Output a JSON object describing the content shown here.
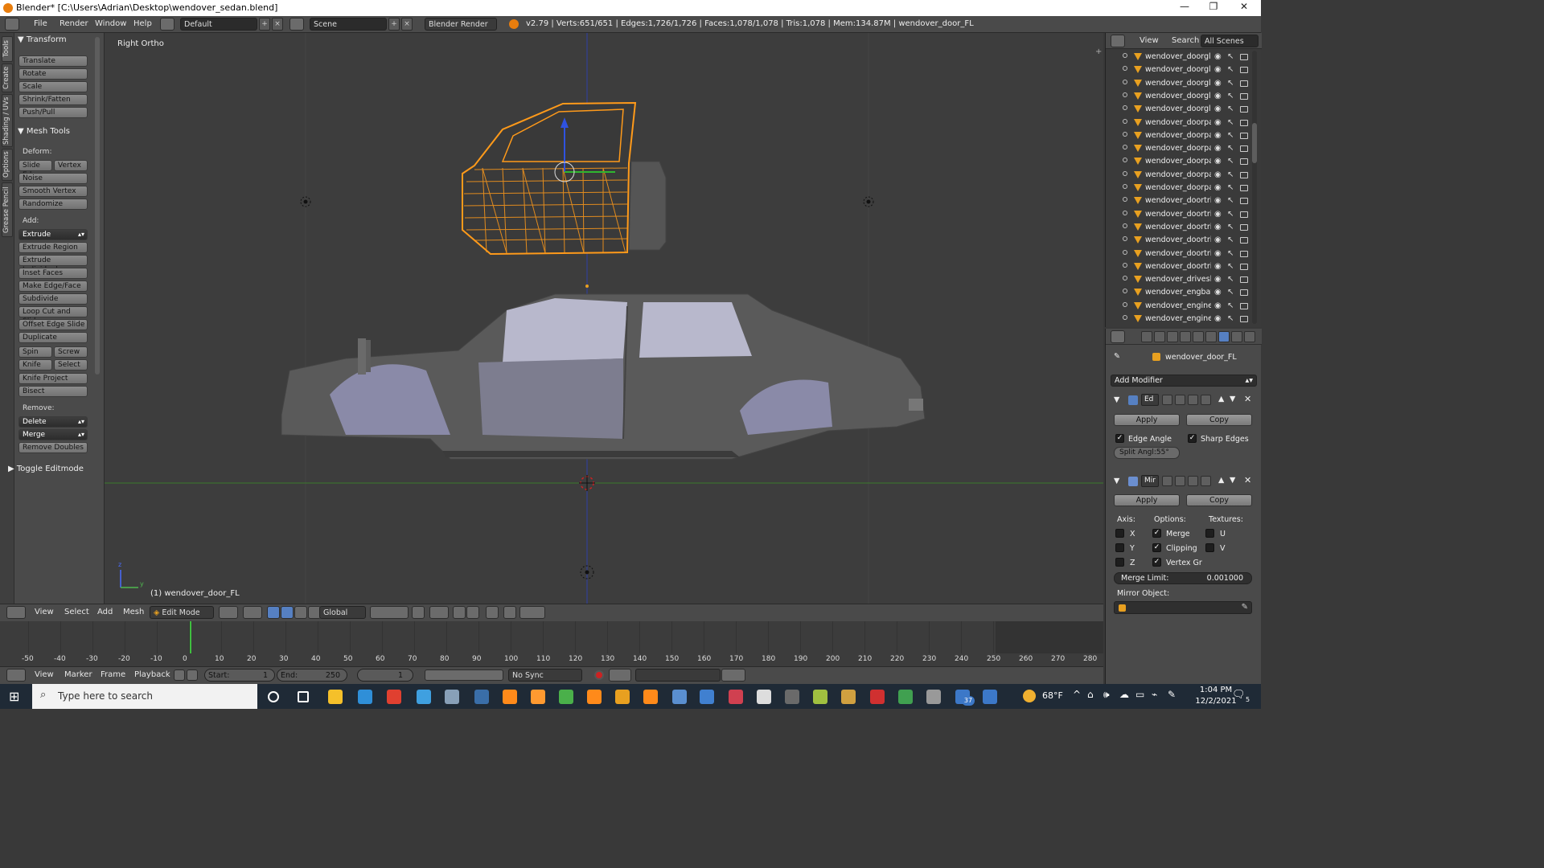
{
  "window": {
    "title": "Blender* [C:\\Users\\Adrian\\Desktop\\wendover_sedan.blend]",
    "minimize": "—",
    "maximize": "❐",
    "close": "✕"
  },
  "menubar": {
    "menus": [
      "File",
      "Render",
      "Window",
      "Help"
    ],
    "layout": "Default",
    "scene": "Scene",
    "engine": "Blender Render",
    "stats": "v2.79 | Verts:651/651 | Edges:1,726/1,726 | Faces:1,078/1,078 | Tris:1,078 | Mem:134.87M | wendover_door_FL"
  },
  "left_tabs": [
    "Tools",
    "Create",
    "Shading / UVs",
    "Options",
    "Grease Pencil"
  ],
  "toolshelf": {
    "transform_header": "Transform",
    "transform": [
      "Translate",
      "Rotate",
      "Scale",
      "Shrink/Fatten",
      "Push/Pull"
    ],
    "mesh_tools_header": "Mesh Tools",
    "deform_label": "Deform:",
    "slide_edge": "Slide Ed",
    "vertex": "Vertex",
    "deform": [
      "Noise",
      "Smooth Vertex",
      "Randomize"
    ],
    "add_label": "Add:",
    "extrude": "Extrude",
    "add": [
      "Extrude Region",
      "Extrude Individual",
      "Inset Faces",
      "Make Edge/Face",
      "Subdivide",
      "Loop Cut and Slide",
      "Offset Edge Slide",
      "Duplicate"
    ],
    "spin": "Spin",
    "screw": "Screw",
    "knife": "Knife",
    "select": "Select",
    "knife_project": "Knife Project",
    "bisect": "Bisect",
    "remove_label": "Remove:",
    "delete": "Delete",
    "merge": "Merge",
    "remove_doubles": "Remove Doubles",
    "toggle_editmode": "Toggle Editmode"
  },
  "viewport": {
    "view_name": "Right Ortho",
    "object_label": "(1) wendover_door_FL"
  },
  "outliner": {
    "view": "View",
    "search": "Search",
    "filter": "All Scenes",
    "items": [
      "wendover_doorglass",
      "wendover_doorglass",
      "wendover_doorglass",
      "wendover_doorglass",
      "wendover_doorglass",
      "wendover_doorpanel",
      "wendover_doorpanel",
      "wendover_doorpanel",
      "wendover_doorpanel",
      "wendover_doorpanel",
      "wendover_doorpanel",
      "wendover_doortrim",
      "wendover_doortrim",
      "wendover_doortrim",
      "wendover_doortrim",
      "wendover_doortrim",
      "wendover_doortrim",
      "wendover_driveshaft",
      "wendover_engbay",
      "wendover_engine_i4",
      "wendover_engine_i6"
    ]
  },
  "properties": {
    "object_name": "wendover_door_FL",
    "add_modifier": "Add Modifier",
    "mod1_name": "Ed",
    "mod2_name": "Mir",
    "apply": "Apply",
    "copy": "Copy",
    "edge_angle": "Edge Angle",
    "sharp_edges": "Sharp Edges",
    "split_angle": "Split Angl:55°",
    "axis_label": "Axis:",
    "options_label": "Options:",
    "textures_label": "Textures:",
    "x": "X",
    "y": "Y",
    "z": "Z",
    "merge": "Merge",
    "clipping": "Clipping",
    "vertex_gr": "Vertex Gr",
    "u": "U",
    "v": "V",
    "merge_limit_label": "Merge Limit:",
    "merge_limit_value": "0.001000",
    "mirror_object": "Mirror Object:"
  },
  "view3d_header": {
    "menus": [
      "View",
      "Select",
      "Add",
      "Mesh"
    ],
    "mode": "Edit Mode",
    "orientation": "Global"
  },
  "timeline": {
    "ticks": [
      "-50",
      "-40",
      "-30",
      "-20",
      "-10",
      "0",
      "10",
      "20",
      "30",
      "40",
      "50",
      "60",
      "70",
      "80",
      "90",
      "100",
      "110",
      "120",
      "130",
      "140",
      "150",
      "160",
      "170",
      "180",
      "190",
      "200",
      "210",
      "220",
      "230",
      "240",
      "250",
      "260",
      "270",
      "280"
    ],
    "menus": [
      "View",
      "Marker",
      "Frame",
      "Playback"
    ],
    "start_label": "Start:",
    "start": "1",
    "end_label": "End:",
    "end": "250",
    "current": "1",
    "sync": "No Sync"
  },
  "taskbar": {
    "search_placeholder": "Type here to search",
    "weather": "68°F",
    "time": "1:04 PM",
    "date": "12/2/2021",
    "badge": "37",
    "notif": "5"
  },
  "colors": {
    "selection": "#ff9a1a",
    "accent_blue": "#5680c2",
    "blender_orange": "#e87d0d"
  }
}
